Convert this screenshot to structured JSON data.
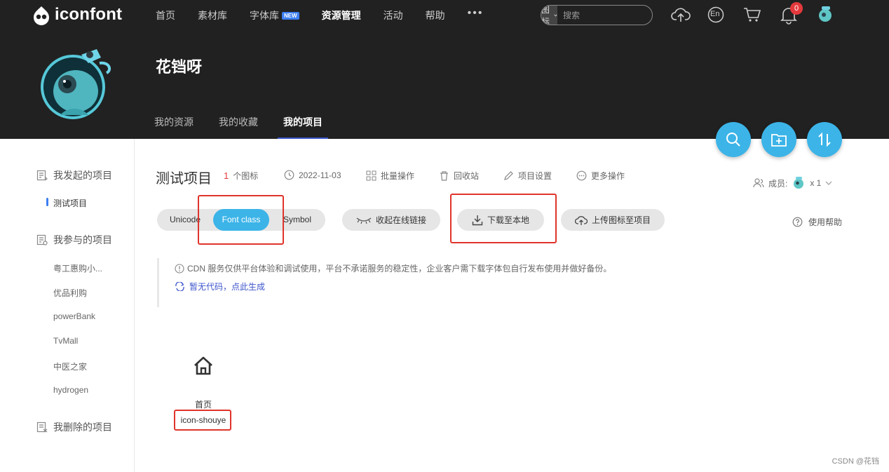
{
  "header": {
    "logo_text": "iconfont",
    "nav": [
      {
        "label": "首页"
      },
      {
        "label": "素材库"
      },
      {
        "label": "字体库",
        "badge": "NEW"
      },
      {
        "label": "资源管理",
        "active": true
      },
      {
        "label": "活动"
      },
      {
        "label": "帮助"
      }
    ],
    "more": "•••",
    "search": {
      "type_label": "图标",
      "placeholder": "搜索"
    },
    "notification_count": "0",
    "lang_label": "En"
  },
  "profile": {
    "username": "花铛呀",
    "tabs": [
      {
        "label": "我的资源"
      },
      {
        "label": "我的收藏"
      },
      {
        "label": "我的项目",
        "active": true
      }
    ]
  },
  "sidebar": {
    "groups": [
      {
        "label": "我发起的项目",
        "items": [
          "测试项目"
        ]
      },
      {
        "label": "我参与的项目",
        "items": [
          "粤工惠购小...",
          "优品利购",
          "powerBank",
          "TvMall",
          "中医之家",
          "hydrogen"
        ]
      },
      {
        "label": "我删除的项目",
        "items": []
      }
    ],
    "active_item": "测试项目"
  },
  "project": {
    "title": "测试项目",
    "icon_count": "1",
    "icon_count_unit": "个图标",
    "date": "2022-11-03",
    "actions": [
      "批量操作",
      "回收站",
      "项目设置",
      "更多操作"
    ],
    "members_label": "成员:",
    "members_count": "x 1"
  },
  "toolbar": {
    "segments": [
      "Unicode",
      "Font class",
      "Symbol"
    ],
    "active_segment": "Font class",
    "collapse_link": "收起在线链接",
    "download": "下载至本地",
    "upload": "上传图标至项目",
    "help": "使用帮助"
  },
  "notice": {
    "text": "CDN 服务仅供平台体验和调试使用，平台不承诺服务的稳定性，企业客户需下载字体包自行发布使用并做好备份。",
    "link": "暂无代码，点此生成"
  },
  "icons": [
    {
      "name": "首页",
      "class": "icon-shouye",
      "glyph": "home-icon"
    }
  ],
  "watermark": "CSDN @花铛",
  "colors": {
    "header_bg": "#212121",
    "accent": "#3cb4e8",
    "link": "#3d55cc",
    "highlight_box": "#e0342b",
    "count_red": "#e4393c"
  }
}
